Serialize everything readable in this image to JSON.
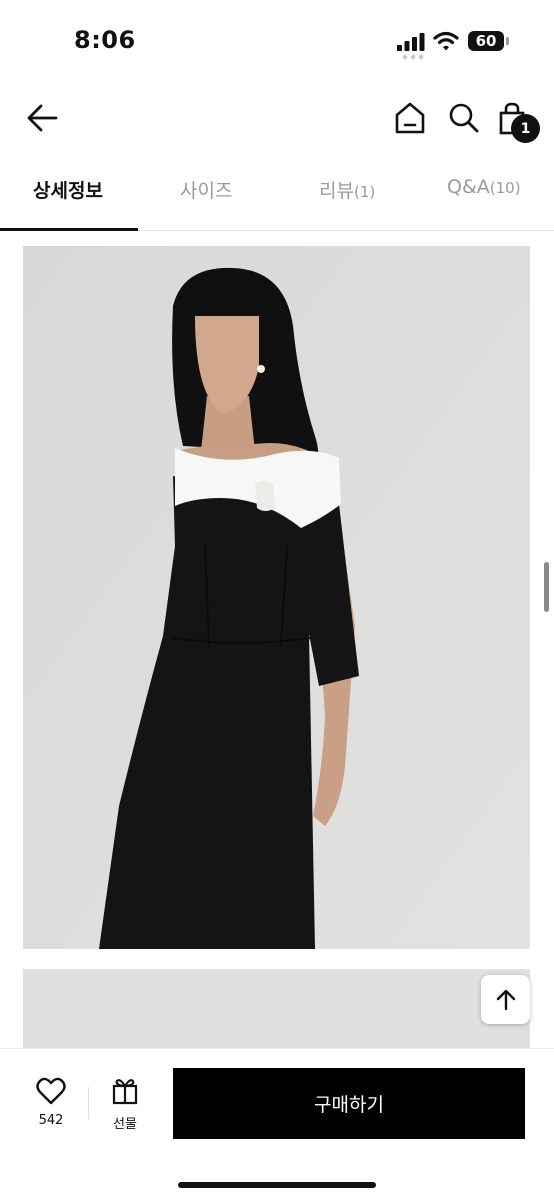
{
  "status_bar": {
    "time": "8:06",
    "battery": "60",
    "icons": [
      "signal-icon",
      "wifi-icon",
      "battery-icon"
    ]
  },
  "header": {
    "icons": [
      "back-arrow-icon",
      "home-icon",
      "search-icon",
      "shopping-bag-icon"
    ],
    "cart_count": "1"
  },
  "tabs": [
    {
      "label": "상세정보",
      "count": "",
      "active": true
    },
    {
      "label": "사이즈",
      "count": "",
      "active": false
    },
    {
      "label": "리뷰",
      "count": "(1)",
      "active": false
    },
    {
      "label": "Q&A",
      "count": "(10)",
      "active": false
    }
  ],
  "content": {
    "images": [
      "product-photo",
      "product-photo"
    ],
    "scroll_top_icon": "arrow-up-icon"
  },
  "bottom_bar": {
    "like_count": "542",
    "gift_label": "선물",
    "buy_label": "구매하기",
    "icons": [
      "heart-icon",
      "gift-icon"
    ]
  },
  "colors": {
    "accent": "#000000",
    "tab_inactive": "#9a9a9a",
    "photo_background": "#dcdcda",
    "dress": "#141414",
    "bow": "#f7f7f5"
  }
}
